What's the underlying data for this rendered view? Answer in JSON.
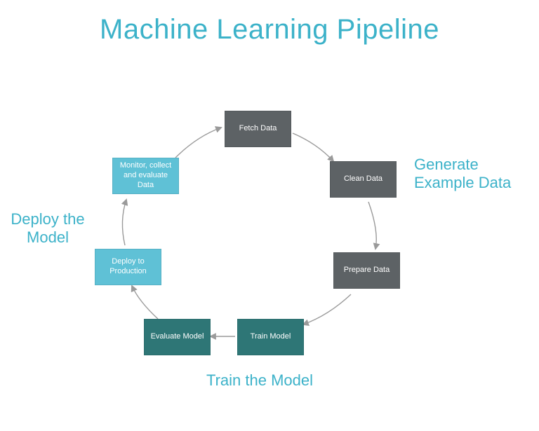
{
  "title": "Machine Learning Pipeline",
  "nodes": {
    "fetch": {
      "label": "Fetch Data",
      "group": "data"
    },
    "clean": {
      "label": "Clean Data",
      "group": "data"
    },
    "prepare": {
      "label": "Prepare Data",
      "group": "data"
    },
    "train": {
      "label": "Train Model",
      "group": "train"
    },
    "evaluate": {
      "label": "Evaluate Model",
      "group": "train"
    },
    "deploy": {
      "label": "Deploy to Production",
      "group": "deploy"
    },
    "monitor": {
      "label": "Monitor, collect and evaluate Data",
      "group": "deploy"
    }
  },
  "phases": {
    "data": "Generate Example Data",
    "train": "Train the Model",
    "deploy": "Deploy the Model"
  },
  "colors": {
    "title": "#3cb2c9",
    "data": "#5d6265",
    "train": "#2e7676",
    "deploy": "#5fc1d6",
    "arrow": "#9a9a9a"
  },
  "cycle_order": [
    "fetch",
    "clean",
    "prepare",
    "train",
    "evaluate",
    "deploy",
    "monitor"
  ]
}
